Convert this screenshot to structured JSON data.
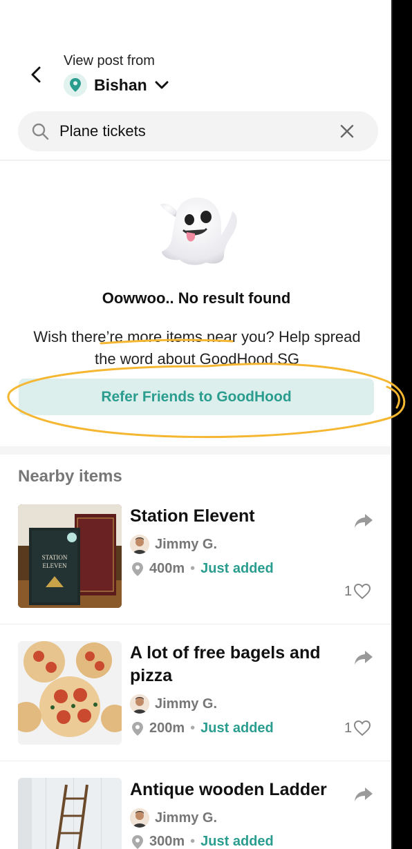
{
  "header": {
    "view_label": "View post from",
    "location": "Bishan"
  },
  "search": {
    "value": "Plane tickets",
    "placeholder": "Search"
  },
  "empty_state": {
    "title": "Oowwoo.. No result found",
    "description": "Wish there’re more items near you? Help spread the word about GoodHood.SG",
    "cta_label": "Refer Friends to GoodHood"
  },
  "nearby": {
    "title": "Nearby items",
    "items": [
      {
        "title": "Station Elevent",
        "user": "Jimmy G.",
        "distance": "400m",
        "status": "Just added",
        "likes": "1"
      },
      {
        "title": "A lot of free bagels and pizza",
        "user": "Jimmy G.",
        "distance": "200m",
        "status": "Just added",
        "likes": "1"
      },
      {
        "title": "Antique wooden Ladder",
        "user": "Jimmy G.",
        "distance": "300m",
        "status": "Just added",
        "likes": ""
      }
    ]
  },
  "colors": {
    "accent": "#2a9d8f",
    "accent_bg": "#dcefec",
    "annotation": "#f5b731"
  },
  "icons": [
    "back-arrow-icon",
    "location-pin-icon",
    "chevron-down-icon",
    "search-icon",
    "close-icon",
    "ghost-emoji-icon",
    "share-icon",
    "heart-icon"
  ]
}
